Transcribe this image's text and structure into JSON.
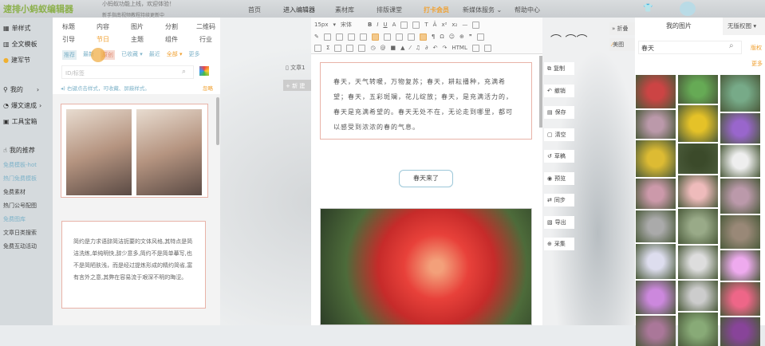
{
  "header": {
    "logo": "速排小蚂蚁编辑器",
    "notices": [
      "小蚂蚁功能上线，欢迎体验！",
      "新手指南视频教程持续更新中"
    ],
    "nav": [
      "首页",
      "进入编辑器",
      "素材库",
      "排版课堂",
      "打卡会员",
      "新媒体服务 ⌄",
      "帮助中心"
    ]
  },
  "sidebar": {
    "items": [
      "单样式",
      "全文模板",
      "建军节"
    ],
    "more": [
      "我的",
      "爆文速成",
      "工具宝箱"
    ],
    "recommend_title": "我的推荐",
    "links": [
      {
        "label": "免费模板-hot",
        "color": "#7fb3c9"
      },
      {
        "label": "热门免费模板",
        "color": "#7fb3c9"
      },
      {
        "label": "免费素材",
        "color": "#444"
      },
      {
        "label": "热门公号配图",
        "color": "#444"
      },
      {
        "label": "免费图库",
        "color": "#7fb3c9"
      },
      {
        "label": "文章日类搜索",
        "color": "#444"
      },
      {
        "label": "免费互动活动",
        "color": "#444"
      }
    ]
  },
  "panel": {
    "tabs_row1": [
      "标题",
      "内容",
      "图片",
      "分割",
      "二维码"
    ],
    "tabs_row2": [
      "引导",
      "节日",
      "主题",
      "组件",
      "行业"
    ],
    "active_tab": "节日",
    "filters": [
      "推荐",
      "最新",
      "原创",
      "已收藏 ▾",
      "最近",
      "全部 ▾",
      "更多"
    ],
    "search_placeholder": "ID/标签",
    "hint": "◂) 右键点击样式，可收藏、屏蔽样式。",
    "hint_link": "忽略",
    "sample_text": "简约是力求语辞简洁扼要的文体风格,其特点是简洁洗练,单纯明快,辞少意多,简约不是简单摹写,也不是简陋肤浅，而是经过提炼形成的精约简省,富有言外之意,其弊在容易流于艰深不明的晦涩。"
  },
  "editor": {
    "font_size": "15px",
    "font_family": "宋体",
    "doc_name": "文章1",
    "new_label": "+ 新 建",
    "paragraph": "春天，天气转暖，万物复苏；春天，耕耘播种，充满希望；春天，五彩斑斓，花儿绽放；春天，是充满活力的，春天是充满希望的。春天无处不在，无论走到哪里，都可以感受到浓浓的春的气息。",
    "title_badge": "春天来了"
  },
  "tools": [
    "复制",
    "撤销",
    "保存",
    "清空",
    "草稿",
    "预览",
    "同步",
    "导出",
    "采集"
  ],
  "toggles": {
    "collapse": "» 折叠",
    "meitu": "美图"
  },
  "images": {
    "title": "我的图片",
    "copyright_select": "无版权图 ▾",
    "search_value": "春天",
    "copyright_link": "版权",
    "more": "更多"
  },
  "colors": {
    "accent": "#f0a030",
    "green": "#8bb04a",
    "link_blue": "#7fb3c9"
  }
}
